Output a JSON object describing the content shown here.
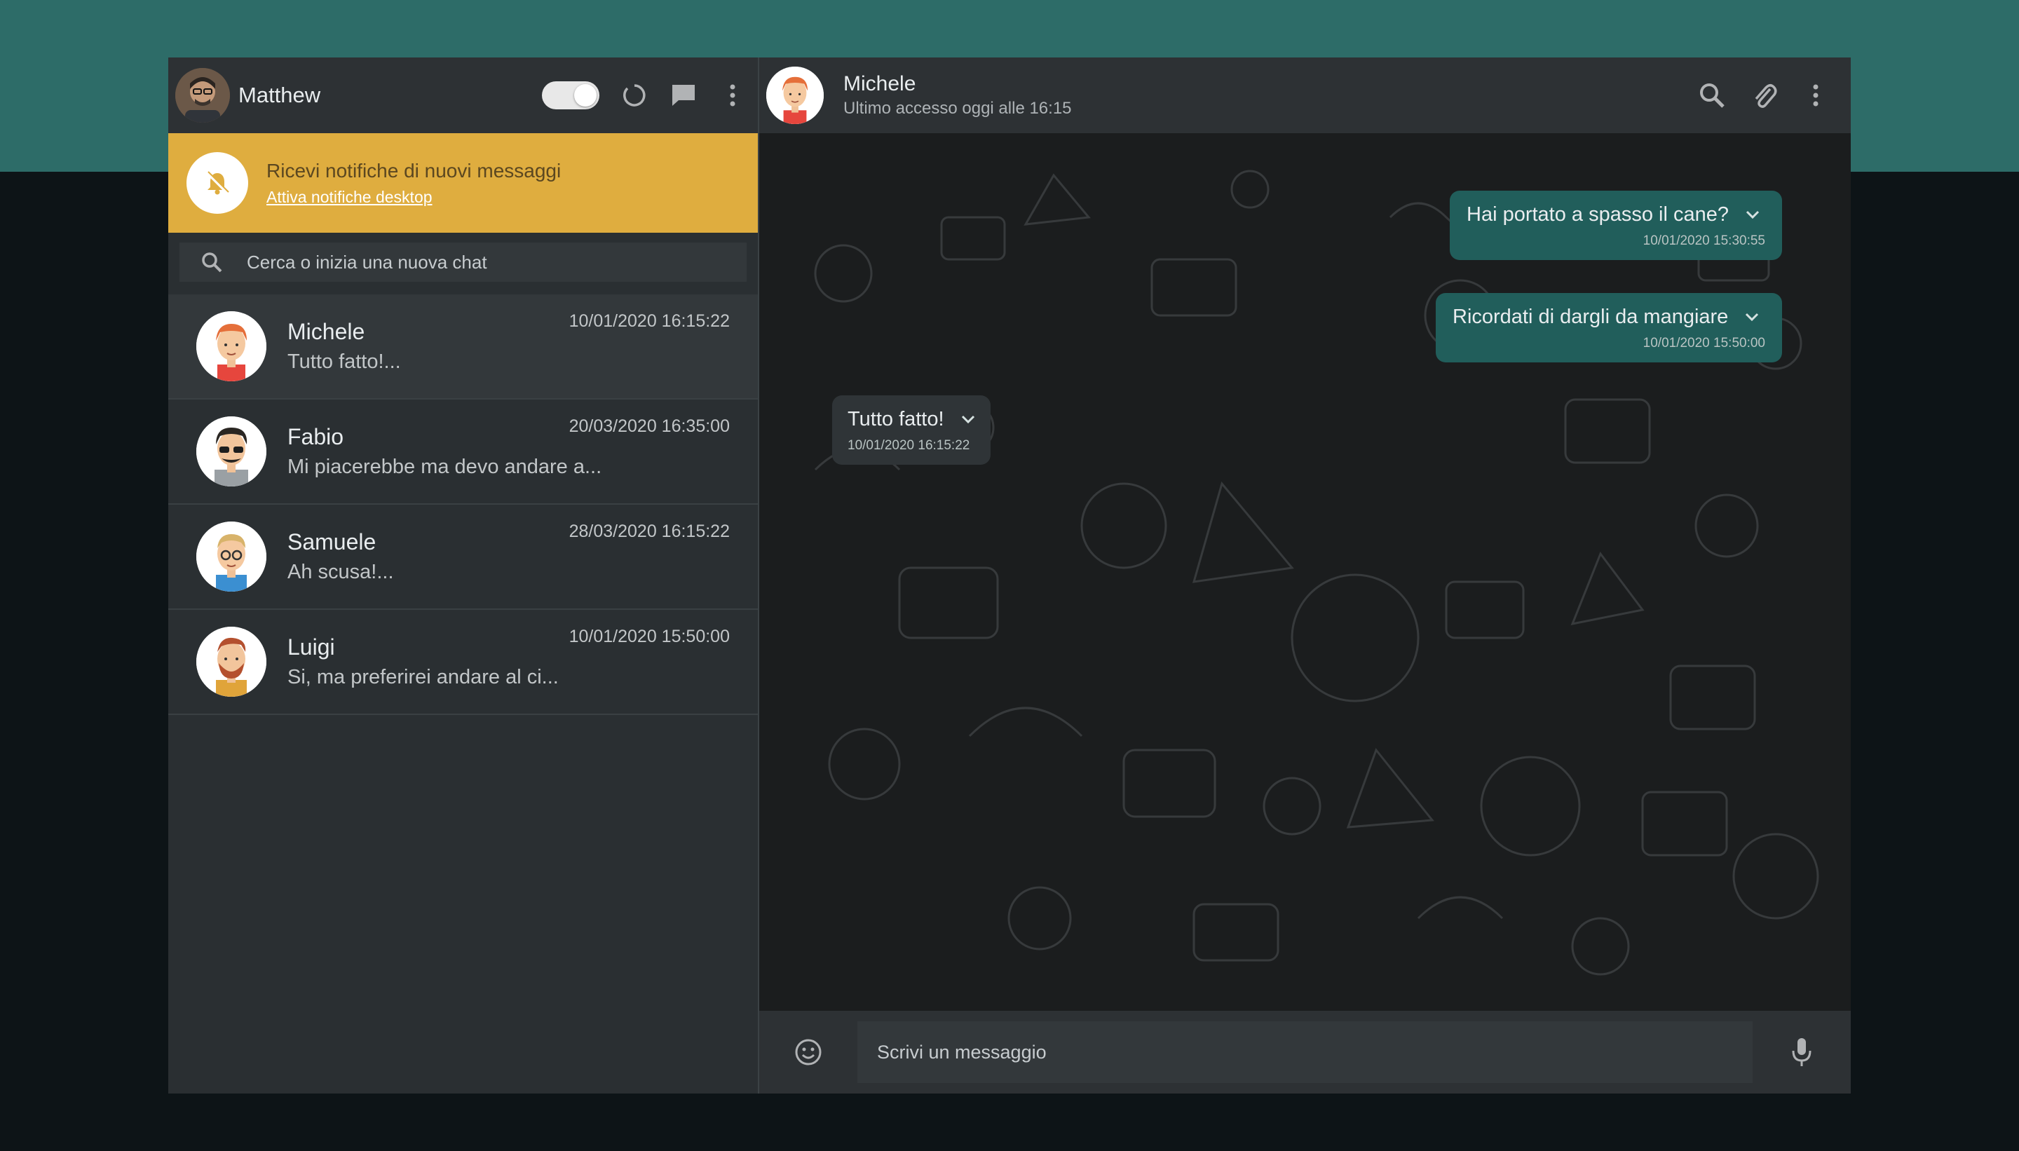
{
  "me": {
    "name": "Matthew"
  },
  "notification": {
    "title": "Ricevi notifiche di nuovi messaggi",
    "link": "Attiva notifiche desktop"
  },
  "search": {
    "placeholder": "Cerca o inizia una nuova chat"
  },
  "chats": [
    {
      "name": "Michele",
      "preview": "Tutto fatto!...",
      "time": "10/01/2020 16:15:22"
    },
    {
      "name": "Fabio",
      "preview": "Mi piacerebbe ma devo andare a...",
      "time": "20/03/2020 16:35:00"
    },
    {
      "name": "Samuele",
      "preview": "Ah scusa!...",
      "time": "28/03/2020 16:15:22"
    },
    {
      "name": "Luigi",
      "preview": "Si, ma preferirei andare al ci...",
      "time": "10/01/2020 15:50:00"
    }
  ],
  "contact": {
    "name": "Michele",
    "status": "Ultimo accesso oggi alle 16:15"
  },
  "messages": [
    {
      "text": "Hai portato a spasso il cane?",
      "time": "10/01/2020 15:30:55",
      "direction": "out"
    },
    {
      "text": "Ricordati di dargli da mangiare",
      "time": "10/01/2020 15:50:00",
      "direction": "out"
    },
    {
      "text": "Tutto fatto!",
      "time": "10/01/2020 16:15:22",
      "direction": "in"
    }
  ],
  "composer": {
    "placeholder": "Scrivi un messaggio"
  },
  "colors": {
    "accent": "#2d6c68",
    "outgoing_bubble": "#215e5b",
    "notification": "#dfad3f"
  }
}
